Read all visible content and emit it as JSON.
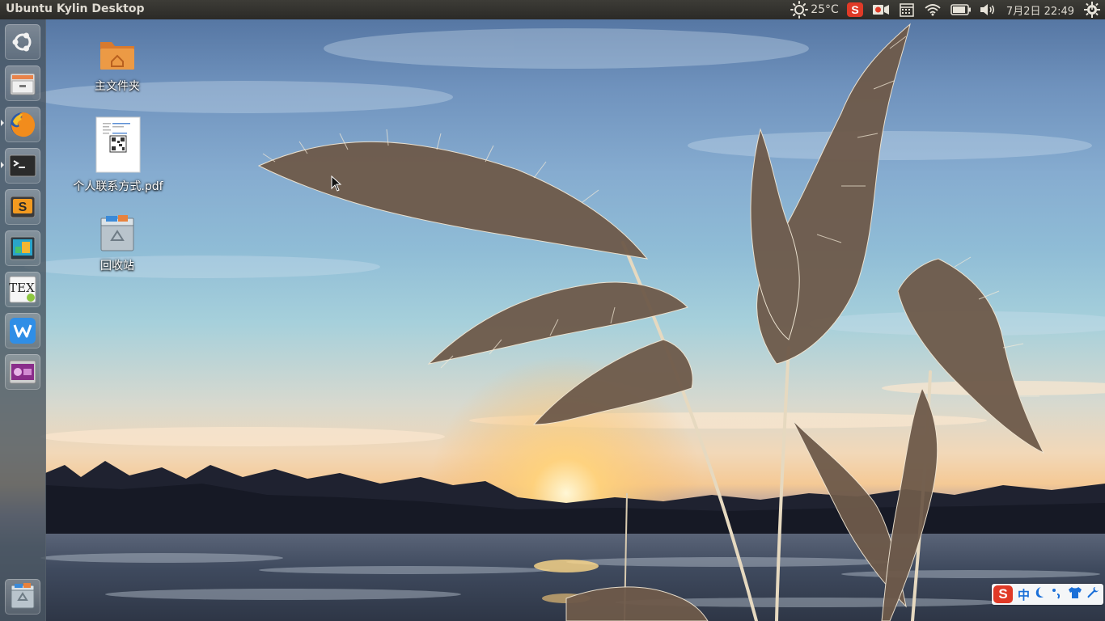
{
  "top_panel": {
    "window_title": "Ubuntu Kylin Desktop",
    "weather": {
      "icon": "sun-icon",
      "temperature": "25°C"
    },
    "indicators": [
      "sogou-input-icon",
      "screen-record-icon",
      "calendar-icon",
      "wifi-icon",
      "battery-icon",
      "volume-icon"
    ],
    "clock": "7月2日 22:49",
    "session_icon": "power-gear-icon"
  },
  "launcher": {
    "items": [
      {
        "name": "dash-home",
        "icon": "ubuntu-logo-icon"
      },
      {
        "name": "file-manager",
        "icon": "file-cabinet-icon"
      },
      {
        "name": "firefox",
        "icon": "firefox-icon",
        "running": true
      },
      {
        "name": "terminal",
        "icon": "terminal-icon",
        "running": true
      },
      {
        "name": "sublime-text",
        "icon": "sublime-icon"
      },
      {
        "name": "ubuntu-kylin-software-center",
        "icon": "software-center-icon"
      },
      {
        "name": "texmaker",
        "icon": "tex-icon",
        "label": "TEX"
      },
      {
        "name": "wps",
        "icon": "wps-icon",
        "label": "W"
      },
      {
        "name": "video-player",
        "icon": "video-player-icon"
      }
    ],
    "trash": {
      "name": "trash",
      "icon": "trash-icon"
    }
  },
  "desktop": {
    "icons": [
      {
        "label": "主文件夹",
        "icon": "home-folder-icon"
      },
      {
        "label": "个人联系方式.pdf",
        "icon": "pdf-document-icon"
      },
      {
        "label": "回收站",
        "icon": "trash-icon"
      }
    ]
  },
  "ime_bar": {
    "logo": "S",
    "mode": "中",
    "items": [
      "moon-icon",
      "punctuation-icon",
      "skin-shirt-icon",
      "wrench-icon"
    ]
  },
  "colors": {
    "panel_bg": "#2b2a27",
    "launcher_bg": "#46525c",
    "ime_accent": "#1a6fd8",
    "sogou_red": "#e03a27"
  }
}
